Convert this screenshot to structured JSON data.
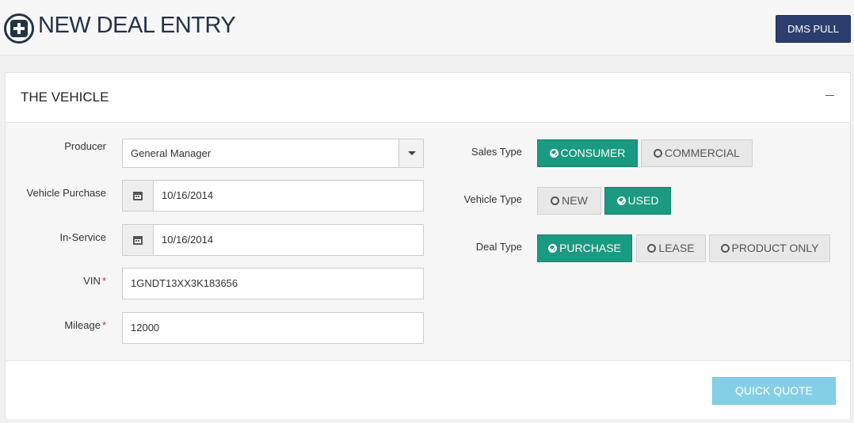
{
  "header": {
    "title": "NEW DEAL ENTRY",
    "dms_button": "DMS PULL"
  },
  "panel": {
    "title": "THE VEHICLE",
    "fields": {
      "producer": {
        "label": "Producer",
        "value": "General Manager"
      },
      "vehicle_purchase": {
        "label": "Vehicle Purchase",
        "value": "10/16/2014"
      },
      "in_service": {
        "label": "In-Service",
        "value": "10/16/2014"
      },
      "vin": {
        "label": "VIN",
        "required": "*",
        "value": "1GNDT13XX3K183656"
      },
      "mileage": {
        "label": "Mileage",
        "required": "*",
        "value": "12000"
      }
    },
    "sales_type": {
      "label": "Sales Type",
      "options": [
        {
          "label": "CONSUMER",
          "selected": true
        },
        {
          "label": "COMMERCIAL",
          "selected": false
        }
      ]
    },
    "vehicle_type": {
      "label": "Vehicle Type",
      "options": [
        {
          "label": "NEW",
          "selected": false
        },
        {
          "label": "USED",
          "selected": true
        }
      ]
    },
    "deal_type": {
      "label": "Deal Type",
      "options": [
        {
          "label": "PURCHASE",
          "selected": true
        },
        {
          "label": "LEASE",
          "selected": false
        },
        {
          "label": "PRODUCT ONLY",
          "selected": false
        }
      ]
    },
    "footer": {
      "quick_quote": "QUICK QUOTE"
    }
  },
  "colors": {
    "selected": "#1a9a81",
    "navy": "#2c3e6e",
    "info": "#5bc0de"
  }
}
